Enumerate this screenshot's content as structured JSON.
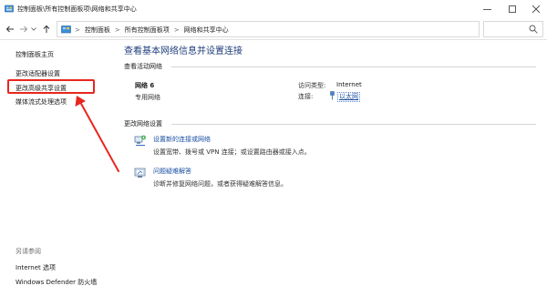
{
  "window": {
    "title": "控制面板\\所有控制面板项\\网络和共享中心"
  },
  "address_bar": {
    "breadcrumbs": [
      "控制面板",
      "所有控制面板项",
      "网络和共享中心"
    ],
    "separator": ">"
  },
  "sidebar": {
    "items": [
      {
        "label": "控制面板主页"
      },
      {
        "label": "更改适配器设置"
      },
      {
        "label": "更改高级共享设置"
      },
      {
        "label": "媒体流式处理选项"
      }
    ],
    "see_also_label": "另请参阅",
    "see_also": [
      {
        "label": "Internet 选项"
      },
      {
        "label": "Windows Defender 防火墙"
      }
    ]
  },
  "main": {
    "title": "查看基本网络信息并设置连接",
    "active_networks_label": "查看活动网络",
    "network": {
      "name": "网络 6",
      "type": "专用网络",
      "access_type_label": "访问类型:",
      "access_type_value": "Internet",
      "connection_label": "连接:",
      "connection_value": "以太网"
    },
    "change_settings_label": "更改网络设置",
    "tasks": [
      {
        "icon": "new-connection-icon",
        "link": "设置新的连接或网络",
        "desc": "设置宽带、拨号或 VPN 连接；或设置路由器或接入点。"
      },
      {
        "icon": "troubleshoot-icon",
        "link": "问题疑难解答",
        "desc": "诊断并修复网络问题，或者获得疑难解答信息。"
      }
    ]
  },
  "colors": {
    "accent_link": "#1a4fa0",
    "title": "#1f3d7a",
    "annotation": "#e8261f"
  }
}
